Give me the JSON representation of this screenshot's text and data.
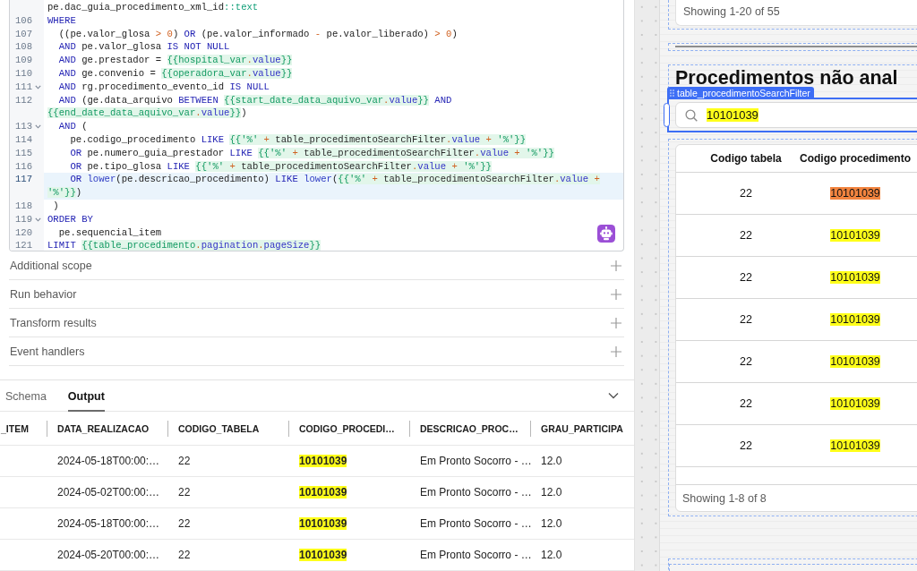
{
  "editor": {
    "lines": [
      {
        "foldable": false,
        "active": false,
        "tokens": [
          {
            "kind": "plain",
            "text": "pe.dac_guia_procedimento_xml_id"
          },
          {
            "kind": "type",
            "text": "::text"
          }
        ]
      },
      {
        "number": "106",
        "foldable": false,
        "active": false,
        "tokens": [
          {
            "kind": "kw",
            "text": "WHERE"
          }
        ]
      },
      {
        "number": "107",
        "foldable": false,
        "active": false,
        "tokens": [
          {
            "kind": "plain",
            "text": "  ((pe.valor_glosa "
          },
          {
            "kind": "op",
            "text": "> "
          },
          {
            "kind": "num",
            "text": "0"
          },
          {
            "kind": "plain",
            "text": ") "
          },
          {
            "kind": "kw",
            "text": "OR "
          },
          {
            "kind": "plain",
            "text": "(pe.valor_informado "
          },
          {
            "kind": "op",
            "text": "- "
          },
          {
            "kind": "plain",
            "text": "pe.valor_liberado) "
          },
          {
            "kind": "op",
            "text": "> "
          },
          {
            "kind": "num",
            "text": "0"
          },
          {
            "kind": "plain",
            "text": ")"
          }
        ]
      },
      {
        "number": "108",
        "foldable": false,
        "active": false,
        "tokens": [
          {
            "kind": "kw",
            "text": "  AND "
          },
          {
            "kind": "plain",
            "text": "pe.valor_glosa "
          },
          {
            "kind": "kw",
            "text": "IS NOT NULL"
          }
        ]
      },
      {
        "number": "109",
        "foldable": false,
        "active": false,
        "tokens": [
          {
            "kind": "kw",
            "text": "  AND "
          },
          {
            "kind": "plain",
            "text": "ge.prestador = "
          },
          {
            "kind": "tpl",
            "text": "{{hospital_var"
          },
          {
            "kind": "tpl_op",
            "text": "."
          },
          {
            "kind": "tpl_prop",
            "text": "value"
          },
          {
            "kind": "tpl",
            "text": "}}"
          }
        ]
      },
      {
        "number": "110",
        "foldable": false,
        "active": false,
        "tokens": [
          {
            "kind": "kw",
            "text": "  AND "
          },
          {
            "kind": "plain",
            "text": "ge.convenio = "
          },
          {
            "kind": "tpl",
            "text": "{{operadora_var"
          },
          {
            "kind": "tpl_op",
            "text": "."
          },
          {
            "kind": "tpl_prop",
            "text": "value"
          },
          {
            "kind": "tpl",
            "text": "}}"
          }
        ]
      },
      {
        "number": "111",
        "foldable": true,
        "active": false,
        "tokens": [
          {
            "kind": "kw",
            "text": "  AND "
          },
          {
            "kind": "plain",
            "text": "rg.procedimento_evento_id "
          },
          {
            "kind": "kw",
            "text": "IS NULL"
          }
        ]
      },
      {
        "number": "112",
        "foldable": false,
        "active": false,
        "tokens": [
          {
            "kind": "kw",
            "text": "  AND "
          },
          {
            "kind": "plain",
            "text": "(ge.data_arquivo "
          },
          {
            "kind": "kw",
            "text": "BETWEEN "
          },
          {
            "kind": "tpl",
            "text": "{{start_date_data_aquivo_var"
          },
          {
            "kind": "tpl_op",
            "text": "."
          },
          {
            "kind": "tpl_prop",
            "text": "value"
          },
          {
            "kind": "tpl",
            "text": "}}"
          },
          {
            "kind": "kw",
            "text": " AND"
          }
        ]
      },
      {
        "foldable": false,
        "active": false,
        "tokens": [
          {
            "kind": "tpl",
            "text": "{{end_date_data_aquivo_var"
          },
          {
            "kind": "tpl_op",
            "text": "."
          },
          {
            "kind": "tpl_prop",
            "text": "value"
          },
          {
            "kind": "tpl",
            "text": "}}"
          },
          {
            "kind": "plain",
            "text": ")"
          }
        ]
      },
      {
        "number": "113",
        "foldable": true,
        "active": false,
        "tokens": [
          {
            "kind": "kw",
            "text": "  AND "
          },
          {
            "kind": "plain",
            "text": "("
          }
        ]
      },
      {
        "number": "114",
        "foldable": false,
        "active": false,
        "tokens": [
          {
            "kind": "plain",
            "text": "    pe.codigo_procedimento "
          },
          {
            "kind": "kw",
            "text": "LIKE "
          },
          {
            "kind": "tpl",
            "text": "{{'%'"
          },
          {
            "kind": "tpl_op",
            "text": " + "
          },
          {
            "kind": "tpl_var",
            "text": "table_procedimentoSearchFilter"
          },
          {
            "kind": "tpl_op",
            "text": "."
          },
          {
            "kind": "tpl_prop",
            "text": "value"
          },
          {
            "kind": "tpl_op",
            "text": " + "
          },
          {
            "kind": "tpl",
            "text": "'%'}}"
          }
        ]
      },
      {
        "number": "115",
        "foldable": false,
        "active": false,
        "tokens": [
          {
            "kind": "kw",
            "text": "    OR "
          },
          {
            "kind": "plain",
            "text": "pe.numero_guia_prestador "
          },
          {
            "kind": "kw",
            "text": "LIKE "
          },
          {
            "kind": "tpl",
            "text": "{{'%'"
          },
          {
            "kind": "tpl_op",
            "text": " + "
          },
          {
            "kind": "tpl_var",
            "text": "table_procedimentoSearchFilter"
          },
          {
            "kind": "tpl_op",
            "text": "."
          },
          {
            "kind": "tpl_prop",
            "text": "value"
          },
          {
            "kind": "tpl_op",
            "text": " + "
          },
          {
            "kind": "tpl",
            "text": "'%'}}"
          }
        ]
      },
      {
        "number": "116",
        "foldable": false,
        "active": false,
        "tokens": [
          {
            "kind": "kw",
            "text": "    OR "
          },
          {
            "kind": "plain",
            "text": "pe.tipo_glosa "
          },
          {
            "kind": "kw",
            "text": "LIKE "
          },
          {
            "kind": "tpl",
            "text": "{{'%'"
          },
          {
            "kind": "tpl_op",
            "text": " + "
          },
          {
            "kind": "tpl_var",
            "text": "table_procedimentoSearchFilter"
          },
          {
            "kind": "tpl_op",
            "text": "."
          },
          {
            "kind": "tpl_prop",
            "text": "value"
          },
          {
            "kind": "tpl_op",
            "text": " + "
          },
          {
            "kind": "tpl",
            "text": "'%'}}"
          }
        ]
      },
      {
        "number": "117",
        "foldable": false,
        "active": true,
        "tokens": [
          {
            "kind": "kw",
            "text": "    OR "
          },
          {
            "kind": "fn",
            "text": "lower"
          },
          {
            "kind": "plain",
            "text": "(pe.descricao_procedimento) "
          },
          {
            "kind": "kw",
            "text": "LIKE "
          },
          {
            "kind": "fn",
            "text": "lower"
          },
          {
            "kind": "plain",
            "text": "("
          },
          {
            "kind": "tpl",
            "text": "{{'%'"
          },
          {
            "kind": "tpl_op",
            "text": " + "
          },
          {
            "kind": "tpl_var",
            "text": "table_procedimentoSearchFilter"
          },
          {
            "kind": "tpl_op",
            "text": "."
          },
          {
            "kind": "tpl_prop",
            "text": "value"
          },
          {
            "kind": "tpl_op",
            "text": " +"
          }
        ]
      },
      {
        "foldable": false,
        "active": true,
        "tokens": [
          {
            "kind": "tpl",
            "text": "'%'}}"
          },
          {
            "kind": "plain",
            "text": ")"
          }
        ]
      },
      {
        "number": "118",
        "foldable": false,
        "active": false,
        "tokens": [
          {
            "kind": "plain",
            "text": " )"
          }
        ]
      },
      {
        "number": "119",
        "foldable": true,
        "active": false,
        "tokens": [
          {
            "kind": "kw",
            "text": "ORDER BY"
          }
        ]
      },
      {
        "number": "120",
        "foldable": false,
        "active": false,
        "tokens": [
          {
            "kind": "plain",
            "text": "  pe.sequencial_item"
          }
        ]
      },
      {
        "number": "121",
        "foldable": false,
        "active": false,
        "tokens": [
          {
            "kind": "kw",
            "text": "LIMIT "
          },
          {
            "kind": "tpl",
            "text": "{{table_procedimento"
          },
          {
            "kind": "tpl_op",
            "text": "."
          },
          {
            "kind": "tpl_prop",
            "text": "pagination"
          },
          {
            "kind": "tpl_op",
            "text": "."
          },
          {
            "kind": "tpl_prop",
            "text": "pageSize"
          },
          {
            "kind": "tpl",
            "text": "}}"
          }
        ]
      }
    ]
  },
  "sections": [
    {
      "label": "Additional scope",
      "expanded": false
    },
    {
      "label": "Run behavior",
      "expanded": false
    },
    {
      "label": "Transform results",
      "expanded": false
    },
    {
      "label": "Event handlers",
      "expanded": false
    }
  ],
  "tabs": [
    {
      "label": "Schema",
      "selected": false
    },
    {
      "label": "Output",
      "selected": true
    }
  ],
  "output_table": {
    "columns": [
      "_ITEM",
      "DATA_REALIZACAO",
      "CODIGO_TABELA",
      "CODIGO_PROCEDI…",
      "DESCRICAO_PROC…",
      "GRAU_PARTICIPA"
    ],
    "rows": [
      {
        "cells": [
          {
            "match": false
          },
          {
            "text": "2024-05-18T00:00:…",
            "match": false
          },
          {
            "text": "22",
            "match": false
          },
          {
            "text": "10101039",
            "match": true
          },
          {
            "text": "Em Pronto Socorro - …",
            "match": false
          },
          {
            "text": "12.0",
            "match": false
          }
        ]
      },
      {
        "cells": [
          {
            "match": false
          },
          {
            "text": "2024-05-02T00:00:…",
            "match": false
          },
          {
            "text": "22",
            "match": false
          },
          {
            "text": "10101039",
            "match": true
          },
          {
            "text": "Em Pronto Socorro - …",
            "match": false
          },
          {
            "text": "12.0",
            "match": false
          }
        ]
      },
      {
        "cells": [
          {
            "match": false
          },
          {
            "text": "2024-05-18T00:00:…",
            "match": false
          },
          {
            "text": "22",
            "match": false
          },
          {
            "text": "10101039",
            "match": true
          },
          {
            "text": "Em Pronto Socorro - …",
            "match": false
          },
          {
            "text": "12.0",
            "match": false
          }
        ]
      },
      {
        "cells": [
          {
            "match": false
          },
          {
            "text": "2024-05-20T00:00:…",
            "match": false
          },
          {
            "text": "22",
            "match": false
          },
          {
            "text": "10101039",
            "match": true
          },
          {
            "text": "Em Pronto Socorro - …",
            "match": false
          },
          {
            "text": "12.0",
            "match": false
          }
        ]
      }
    ]
  },
  "canvas": {
    "top_footer": "Showing 1-20 of 55",
    "title": "Procedimentos não anal",
    "search_filter": {
      "tag": "table_procedimentoSearchFilter",
      "selected": true,
      "value": "10101039",
      "match": true
    },
    "table": {
      "columns": [
        "Codigo tabela",
        "Codigo procedimento"
      ],
      "rows": [
        {
          "cells": [
            {
              "text": "22",
              "match": false,
              "current": false
            },
            {
              "text": "10101039",
              "current": true
            }
          ]
        },
        {
          "cells": [
            {
              "text": "22",
              "match": false,
              "current": false
            },
            {
              "text": "10101039",
              "match": true,
              "current": false
            }
          ]
        },
        {
          "cells": [
            {
              "text": "22",
              "match": false,
              "current": false
            },
            {
              "text": "10101039",
              "match": true,
              "current": false
            }
          ]
        },
        {
          "cells": [
            {
              "text": "22",
              "match": false,
              "current": false
            },
            {
              "text": "10101039",
              "match": true,
              "current": false
            }
          ]
        },
        {
          "cells": [
            {
              "text": "22",
              "match": false,
              "current": false
            },
            {
              "text": "10101039",
              "match": true,
              "current": false
            }
          ]
        },
        {
          "cells": [
            {
              "text": "22",
              "match": false,
              "current": false
            },
            {
              "text": "10101039",
              "match": true,
              "current": false
            }
          ]
        },
        {
          "cells": [
            {
              "text": "22",
              "match": false,
              "current": false
            },
            {
              "text": "10101039",
              "match": true,
              "current": false
            }
          ]
        }
      ],
      "footer": "Showing 1-8 of 8"
    }
  }
}
